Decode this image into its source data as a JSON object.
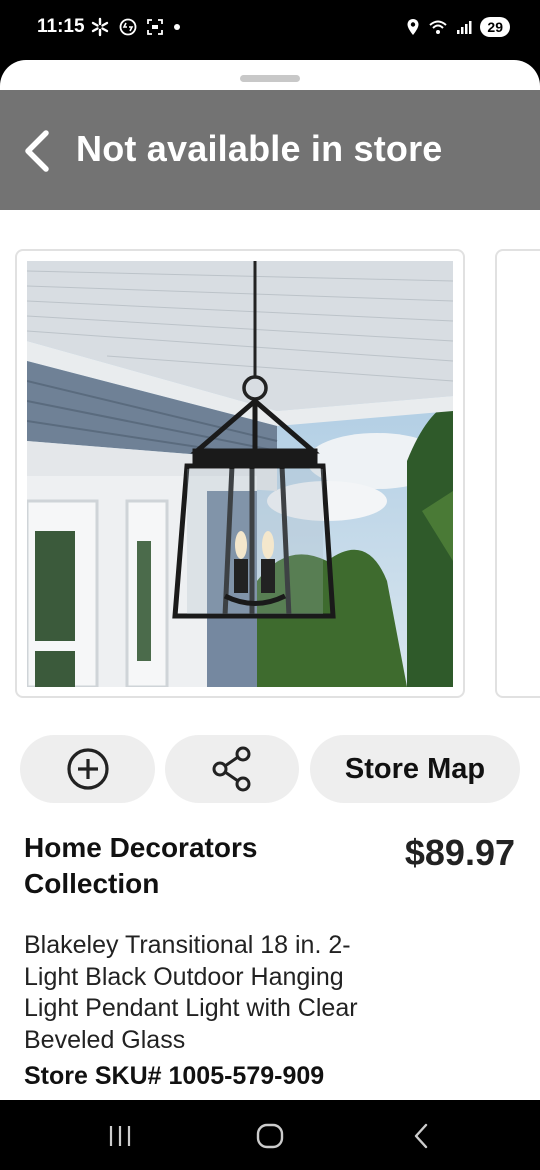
{
  "status_bar": {
    "time": "11:15",
    "battery": "29",
    "left_icons": [
      "walmart-spark-icon",
      "shazam-icon",
      "screenshot-icon",
      "dot-icon"
    ],
    "right_icons": [
      "location-icon",
      "wifi-icon",
      "signal-icon"
    ]
  },
  "header": {
    "title": "Not available in store"
  },
  "product": {
    "brand": "Home Decorators Collection",
    "price": "$89.97",
    "title": "Blakeley Transitional 18 in. 2-Light Black Outdoor Hanging Light Pendant Light with Clear Beveled Glass",
    "sku": "Store SKU# 1005-579-909"
  },
  "actions": {
    "add_icon": "plus-circle-icon",
    "share_icon": "share-icon",
    "store_map_label": "Store Map"
  },
  "nav": {
    "buttons": [
      "recent-apps-icon",
      "home-icon",
      "back-icon"
    ]
  },
  "colors": {
    "header_bg": "#737373",
    "button_bg": "#eeeeee"
  }
}
